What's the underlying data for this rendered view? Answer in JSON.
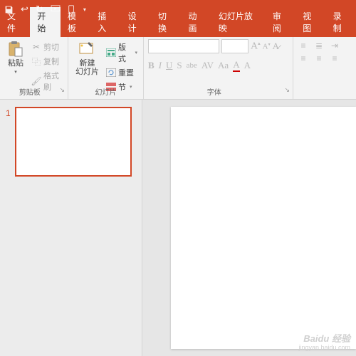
{
  "qat": {
    "save": "保存",
    "undo": "撤销",
    "redo": "重做"
  },
  "tabs": {
    "file": "文件",
    "home": "开始",
    "template": "模板",
    "insert": "插入",
    "design": "设计",
    "transition": "切换",
    "animation": "动画",
    "slideshow": "幻灯片放映",
    "review": "审阅",
    "view": "视图",
    "record": "录制"
  },
  "clipboard": {
    "paste": "粘贴",
    "cut": "剪切",
    "copy": "复制",
    "formatpainter": "格式刷",
    "label": "剪贴板"
  },
  "slides": {
    "newslide": "新建\n幻灯片",
    "layout": "版式",
    "reset": "重置",
    "section": "节",
    "label": "幻灯片"
  },
  "font": {
    "placeholder": "",
    "sizeplaceholder": "",
    "incfont": "A",
    "decfont": "A",
    "label": "字体"
  },
  "slidenum": "1",
  "watermark": {
    "brand": "Baidu 经验",
    "url": "jingyan.baidu.com"
  }
}
